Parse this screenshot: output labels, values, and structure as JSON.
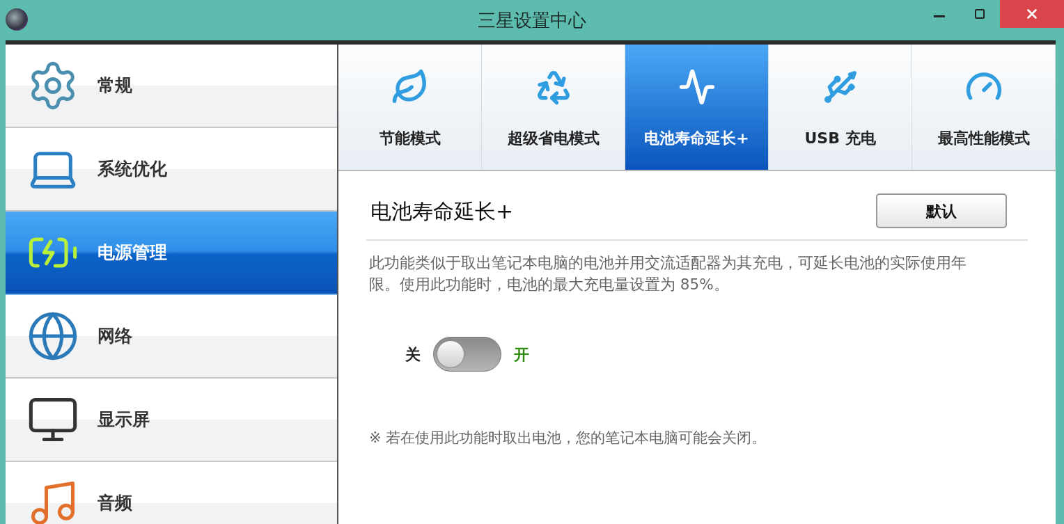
{
  "window": {
    "title": "三星设置中心"
  },
  "sidebar": {
    "items": [
      {
        "label": "常规",
        "selected": false
      },
      {
        "label": "系统优化",
        "selected": false
      },
      {
        "label": "电源管理",
        "selected": true
      },
      {
        "label": "网络",
        "selected": false
      },
      {
        "label": "显示屏",
        "selected": false
      },
      {
        "label": "音频",
        "selected": false
      }
    ]
  },
  "tabs": [
    {
      "label": "节能模式",
      "selected": false
    },
    {
      "label": "超级省电模式",
      "selected": false
    },
    {
      "label": "电池寿命延长+",
      "selected": true
    },
    {
      "label": "USB 充电",
      "selected": false
    },
    {
      "label": "最高性能模式",
      "selected": false
    }
  ],
  "panel": {
    "title": "电池寿命延长+",
    "default_button": "默认",
    "description": "此功能类似于取出笔记本电脑的电池并用交流适配器为其充电，可延长电池的实际使用年限。使用此功能时，电池的最大充电量设置为 85%。",
    "toggle": {
      "off_label": "关",
      "on_label": "开",
      "on": false
    },
    "note": "※ 若在使用此功能时取出电池，您的笔记本电脑可能会关闭。"
  }
}
